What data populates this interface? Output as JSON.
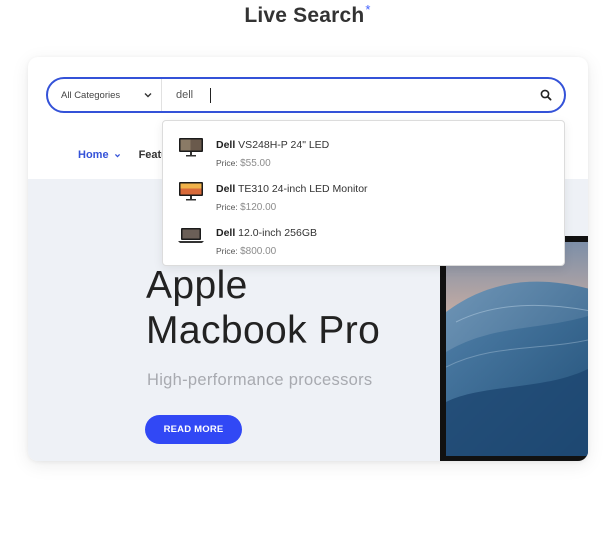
{
  "header": {
    "title": "Live Search",
    "asterisk": "*"
  },
  "search": {
    "category_label": "All Categories",
    "query": "dell",
    "icons": {
      "category": "chevron-down-icon",
      "submit": "search-icon"
    }
  },
  "nav": {
    "home_label": "Home",
    "featured_label": "Featu"
  },
  "results": [
    {
      "brand": "Dell",
      "name": " VS248H-P 24\" LED",
      "price_label": "Price: ",
      "price": "$55.00",
      "icon": "monitor-icon"
    },
    {
      "brand": "Dell",
      "name": " TE310 24-inch LED Monitor",
      "price_label": "Price: ",
      "price": "$120.00",
      "icon": "monitor-icon"
    },
    {
      "brand": "Dell",
      "name": " 12.0-inch 256GB",
      "price_label": "Price: ",
      "price": "$800.00",
      "icon": "laptop-icon"
    }
  ],
  "hero": {
    "title_line1": "Apple",
    "title_line2": "Macbook Pro",
    "subtitle": "High-performance processors",
    "button_label": "READ MORE"
  },
  "colors": {
    "accent": "#3452d8",
    "button": "#3148f5",
    "hero_bg": "#eef1f6"
  }
}
